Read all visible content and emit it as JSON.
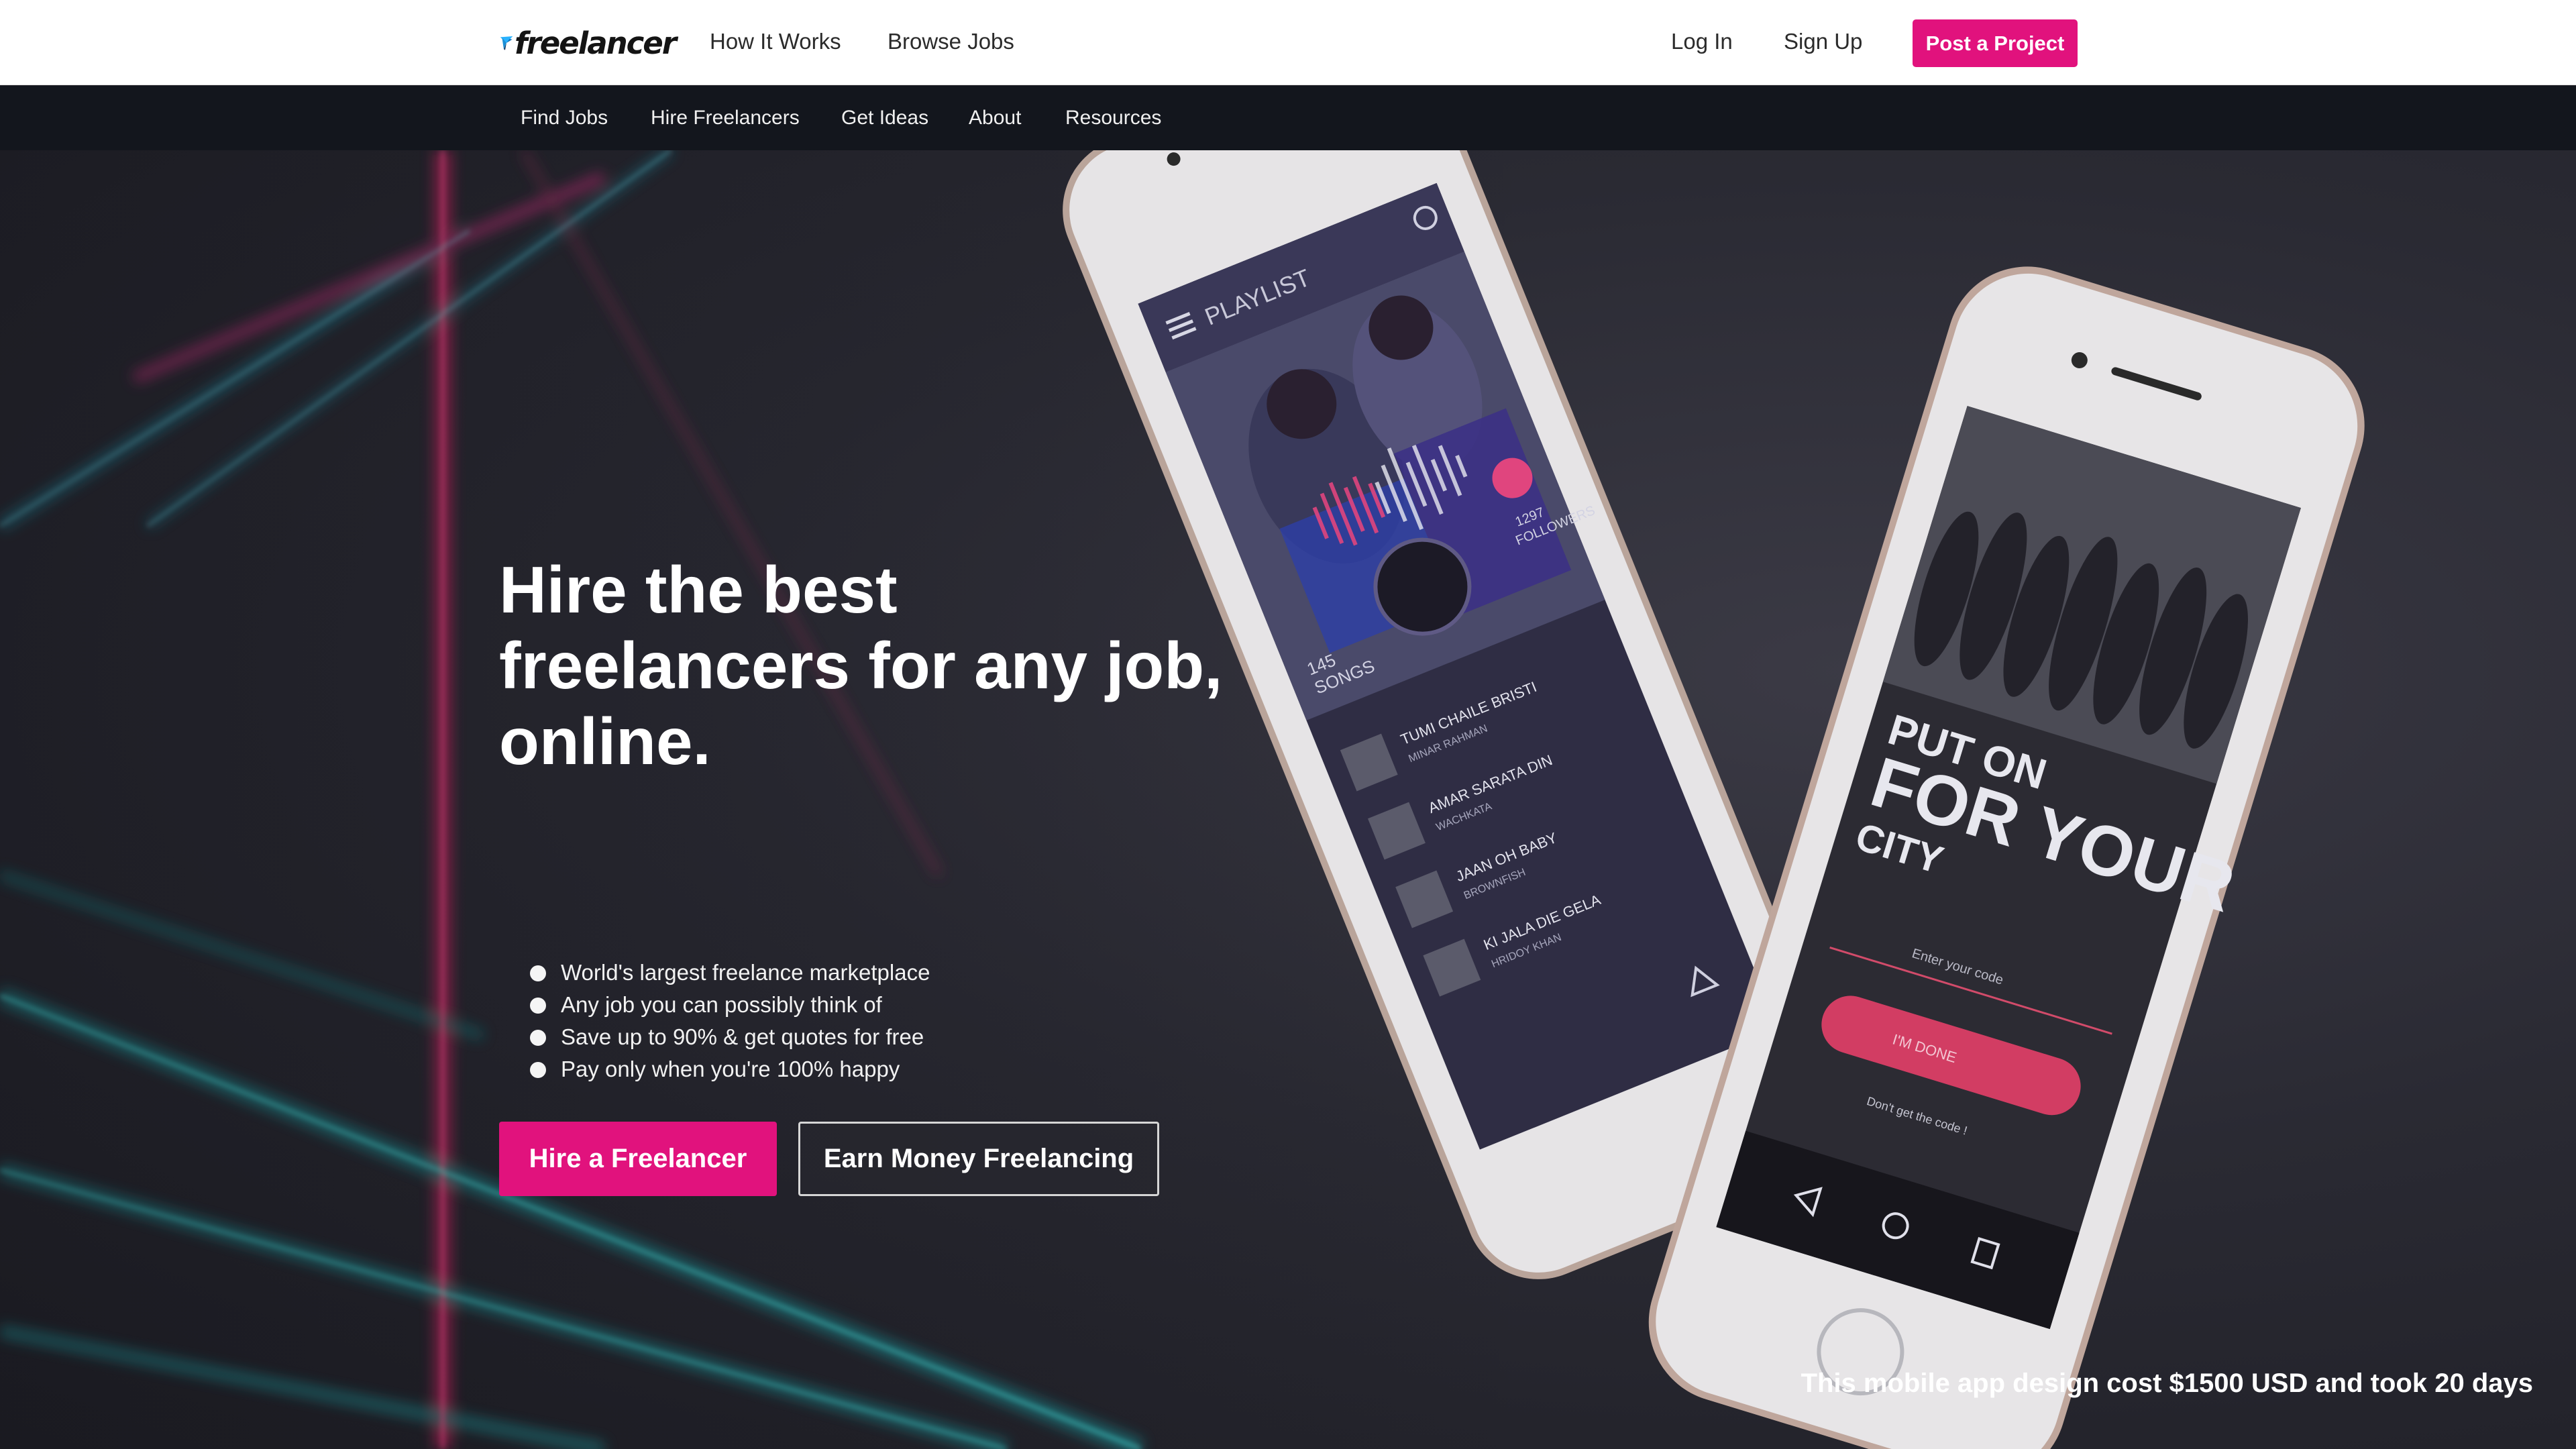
{
  "header": {
    "logo_text": "freelancer",
    "nav": [
      {
        "label": "How It Works"
      },
      {
        "label": "Browse Jobs"
      }
    ],
    "login_label": "Log In",
    "signup_label": "Sign Up",
    "post_project_label": "Post a Project",
    "brand_color": "#e1127d"
  },
  "subnav": {
    "items": [
      {
        "label": "Find Jobs"
      },
      {
        "label": "Hire Freelancers"
      },
      {
        "label": "Get Ideas"
      },
      {
        "label": "About"
      },
      {
        "label": "Resources"
      }
    ]
  },
  "hero": {
    "headline_lines": [
      "Hire the best",
      "freelancers for any job,",
      "online."
    ],
    "bullets": [
      "World's largest freelance marketplace",
      "Any job you can possibly think of",
      "Save up to 90% & get quotes for free",
      "Pay only when you're 100% happy"
    ],
    "hire_button": "Hire a Freelancer",
    "earn_button": "Earn Money Freelancing",
    "caption": "This mobile app design cost $1500 USD and took 20 days"
  },
  "phone_left": {
    "screen_title": "PLAYLIST",
    "songs_count": "145",
    "songs_label": "SONGS",
    "followers_count": "1297",
    "followers_label": "FOLLOWERS",
    "tracks": [
      {
        "title": "TUMI CHAILE BRISTI",
        "artist": "MINAR RAHMAN"
      },
      {
        "title": "AMAR SARATA DIN",
        "artist": "WACHKATA"
      },
      {
        "title": "JAAN OH BABY",
        "artist": "BROWNFISH"
      },
      {
        "title": "KI JALA DIE GELA",
        "artist": "HRIDOY KHAN"
      }
    ]
  },
  "phone_right": {
    "headline_1": "PUT ON",
    "headline_2": "FOR YOUR",
    "headline_3": "CITY",
    "code_placeholder": "Enter your code",
    "done_button": "I'M DONE",
    "resend_text": "Don't get the code !"
  }
}
